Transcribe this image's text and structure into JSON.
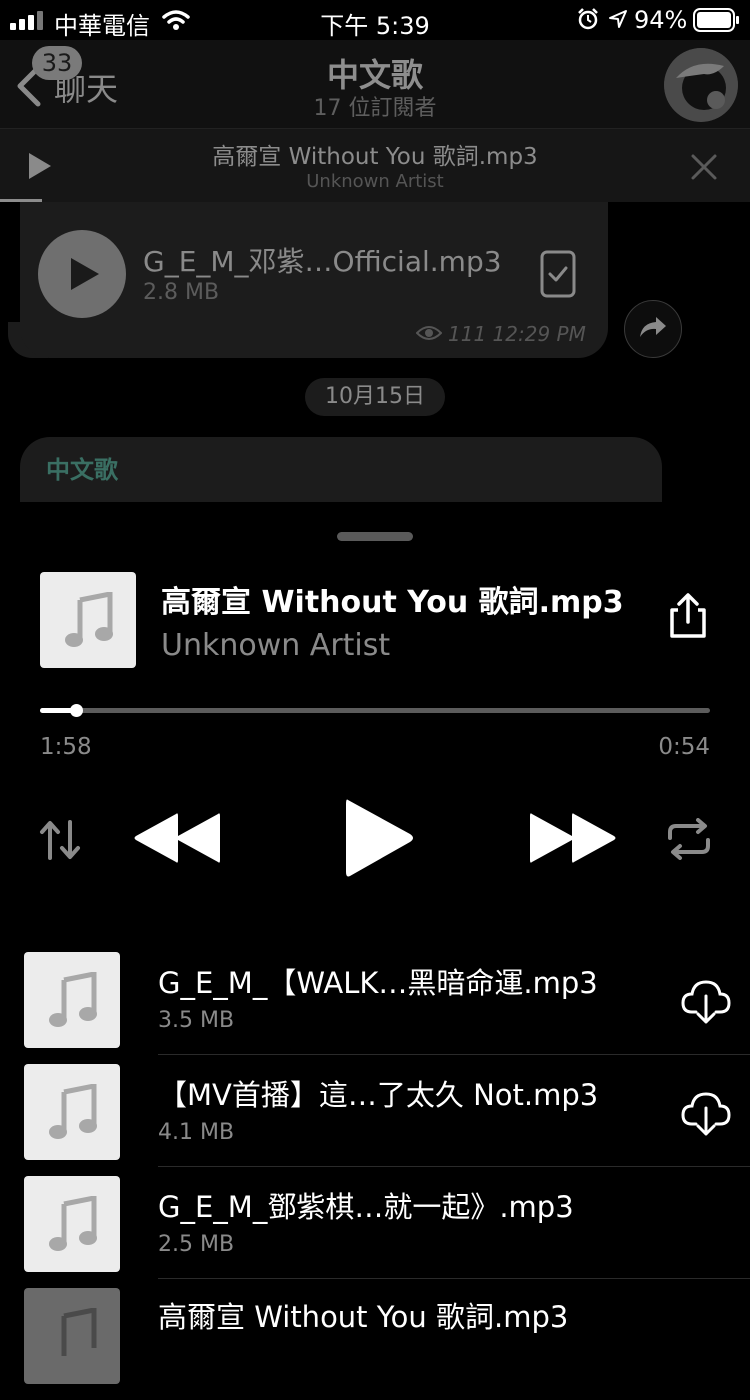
{
  "status_bar": {
    "carrier": "中華電信",
    "time": "下午 5:39",
    "battery": "94%"
  },
  "nav": {
    "back_label": "聊天",
    "unread_badge": "33",
    "title": "中文歌",
    "subtitle": "17 位訂閱者"
  },
  "mini_player": {
    "title": "高爾宣 Without You 歌詞.mp3",
    "artist": "Unknown Artist",
    "progress": 0.05
  },
  "chat": {
    "audio_message": {
      "file_name": "G_E_M_邓紫…Official.mp3",
      "file_size": "2.8 MB",
      "meta": "111 12:29 PM"
    },
    "date_separator": "10月15日",
    "next_message_sender": "中文歌"
  },
  "now_playing": {
    "title": "高爾宣 Without You 歌詞.mp3",
    "artist": "Unknown Artist",
    "elapsed": "1:58",
    "remaining": "0:54",
    "progress": 0.05
  },
  "playlist": [
    {
      "name": "G_E_M_【WALK…黑暗命運.mp3",
      "size": "3.5 MB",
      "downloadable": true
    },
    {
      "name": "【MV首播】這…了太久 Not.mp3",
      "size": "4.1 MB",
      "downloadable": true
    },
    {
      "name": "G_E_M_鄧紫棋…就一起》.mp3",
      "size": "2.5 MB",
      "downloadable": false
    },
    {
      "name": "高爾宣 Without You 歌詞.mp3",
      "size": "",
      "downloadable": false
    }
  ],
  "colors": {
    "background": "#000000",
    "panel": "#1c1c1c",
    "accent_sender": "#3a6f63",
    "muted_text": "#8a8a8a"
  }
}
